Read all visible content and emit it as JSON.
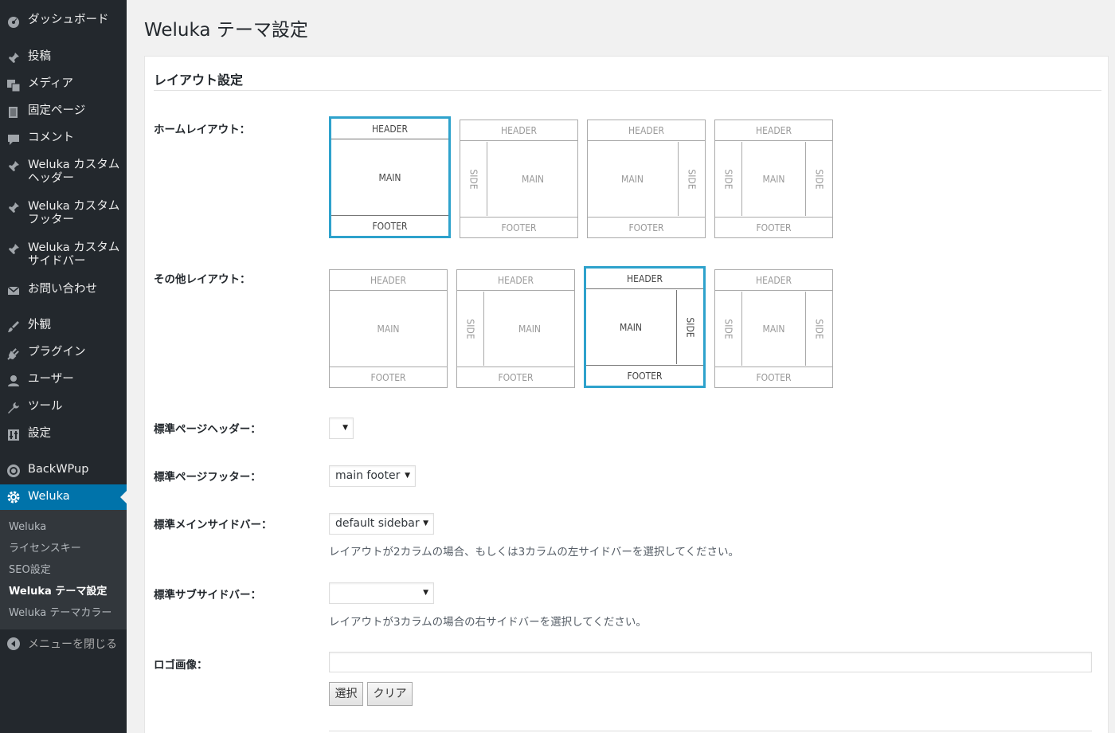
{
  "sidebar": {
    "items": [
      {
        "label": "ダッシュボード",
        "icon": "dashboard-icon"
      },
      {
        "label": "投稿",
        "icon": "pin-icon"
      },
      {
        "label": "メディア",
        "icon": "media-icon"
      },
      {
        "label": "固定ページ",
        "icon": "page-icon"
      },
      {
        "label": "コメント",
        "icon": "comment-icon"
      },
      {
        "label": "Weluka カスタムヘッダー",
        "icon": "pin-icon"
      },
      {
        "label": "Weluka カスタムフッター",
        "icon": "pin-icon"
      },
      {
        "label": "Weluka カスタムサイドバー",
        "icon": "pin-icon"
      },
      {
        "label": "お問い合わせ",
        "icon": "mail-icon"
      },
      {
        "label": "外観",
        "icon": "brush-icon"
      },
      {
        "label": "プラグイン",
        "icon": "plugin-icon"
      },
      {
        "label": "ユーザー",
        "icon": "user-icon"
      },
      {
        "label": "ツール",
        "icon": "wrench-icon"
      },
      {
        "label": "設定",
        "icon": "settings-icon"
      },
      {
        "label": "BackWPup",
        "icon": "backwpup-icon"
      },
      {
        "label": "Weluka",
        "icon": "gear-icon"
      }
    ],
    "submenu": [
      "Weluka",
      "ライセンスキー",
      "SEO設定",
      "Weluka テーマ設定",
      "Weluka テーマカラー"
    ],
    "collapse_label": "メニューを閉じる"
  },
  "page": {
    "title": "Weluka テーマ設定",
    "section_title": "レイアウト設定"
  },
  "layout": {
    "home_label": "ホームレイアウト：",
    "other_label": "その他レイアウト：",
    "header_text": "HEADER",
    "main_text": "MAIN",
    "footer_text": "FOOTER",
    "side_text": "SIDE"
  },
  "fields": {
    "page_header_label": "標準ページヘッダー：",
    "page_header_value": "",
    "page_footer_label": "標準ページフッター：",
    "page_footer_value": "main footer",
    "main_sidebar_label": "標準メインサイドバー：",
    "main_sidebar_value": "default sidebar",
    "main_sidebar_desc": "レイアウトが2カラムの場合、もしくは3カラムの左サイドバーを選択してください。",
    "sub_sidebar_label": "標準サブサイドバー：",
    "sub_sidebar_value": "",
    "sub_sidebar_desc": "レイアウトが3カラムの場合の右サイドバーを選択してください。",
    "logo_label": "ロゴ画像：",
    "logo_value": "",
    "select_button": "選択",
    "clear_button": "クリア"
  },
  "colors": {
    "sidebar_bg": "#23282d",
    "active_bg": "#0073aa",
    "selected_border": "#2ea2cc"
  }
}
